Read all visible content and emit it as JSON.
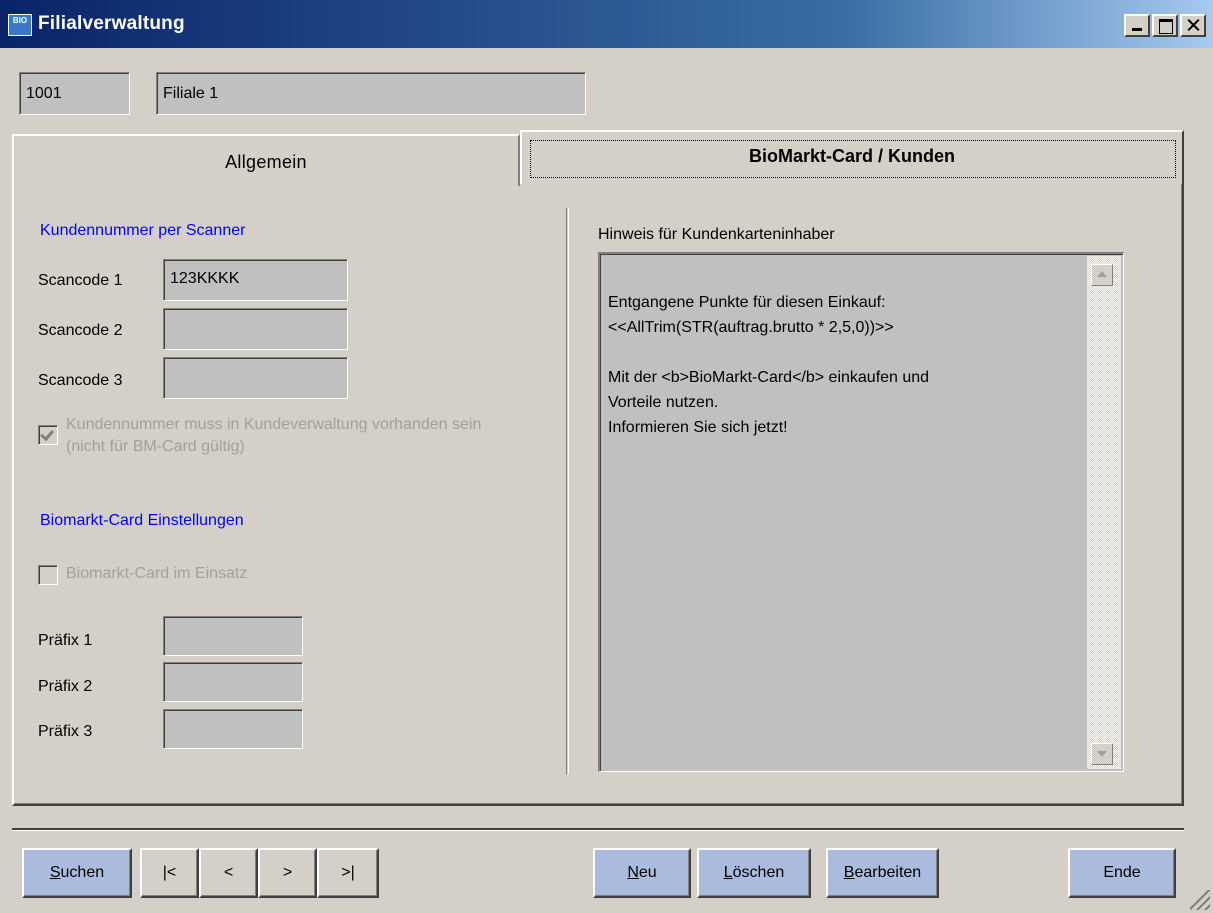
{
  "window": {
    "title": "Filialverwaltung",
    "icon_text": "BIO",
    "icon": "app-icon"
  },
  "header": {
    "number_value": "1001",
    "name_value": "Filiale 1"
  },
  "tabs": [
    {
      "label": "Allgemein",
      "active": false
    },
    {
      "label": "BioMarkt-Card / Kunden",
      "active": true
    }
  ],
  "scanner": {
    "heading": "Kundennummer per Scanner",
    "fields": [
      {
        "label": "Scancode 1",
        "value": "123KKKK"
      },
      {
        "label": "Scancode 2",
        "value": ""
      },
      {
        "label": "Scancode 3",
        "value": ""
      }
    ],
    "checkbox_label": "Kundennummer muss in Kundeverwaltung vorhanden sein (nicht für BM-Card gültig)",
    "checkbox_checked": true
  },
  "biomarkt": {
    "heading": "Biomarkt-Card Einstellungen",
    "checkbox_label": "Biomarkt-Card im Einsatz",
    "checkbox_checked": false,
    "prefixes": [
      {
        "label": "Präfix 1",
        "value": ""
      },
      {
        "label": "Präfix 2",
        "value": ""
      },
      {
        "label": "Präfix 3",
        "value": ""
      }
    ]
  },
  "hinweis": {
    "label": "Hinweis für Kundenkarteninhaber",
    "text": "Entgangene Punkte für diesen Einkauf:\n<<AllTrim(STR(auftrag.brutto * 2,5,0))>>\n\nMit der <b>BioMarkt-Card</b> einkaufen und\nVorteile nutzen.\nInformieren Sie sich jetzt!"
  },
  "footer": {
    "suchen_u": "S",
    "suchen_rest": "uchen",
    "nav": [
      "|<",
      "<",
      ">",
      ">|"
    ],
    "neu_u": "N",
    "neu_rest": "eu",
    "loeschen_u": "L",
    "loeschen_rest": "öschen",
    "bearbeiten_u": "B",
    "bearbeiten_rest": "earbeiten",
    "ende": "Ende"
  },
  "colors": {
    "accent_blue": "#0000ff",
    "button_highlight": "#aabbdd",
    "window_bg": "#d4d0c8",
    "field_bg": "#c0c0c0"
  }
}
